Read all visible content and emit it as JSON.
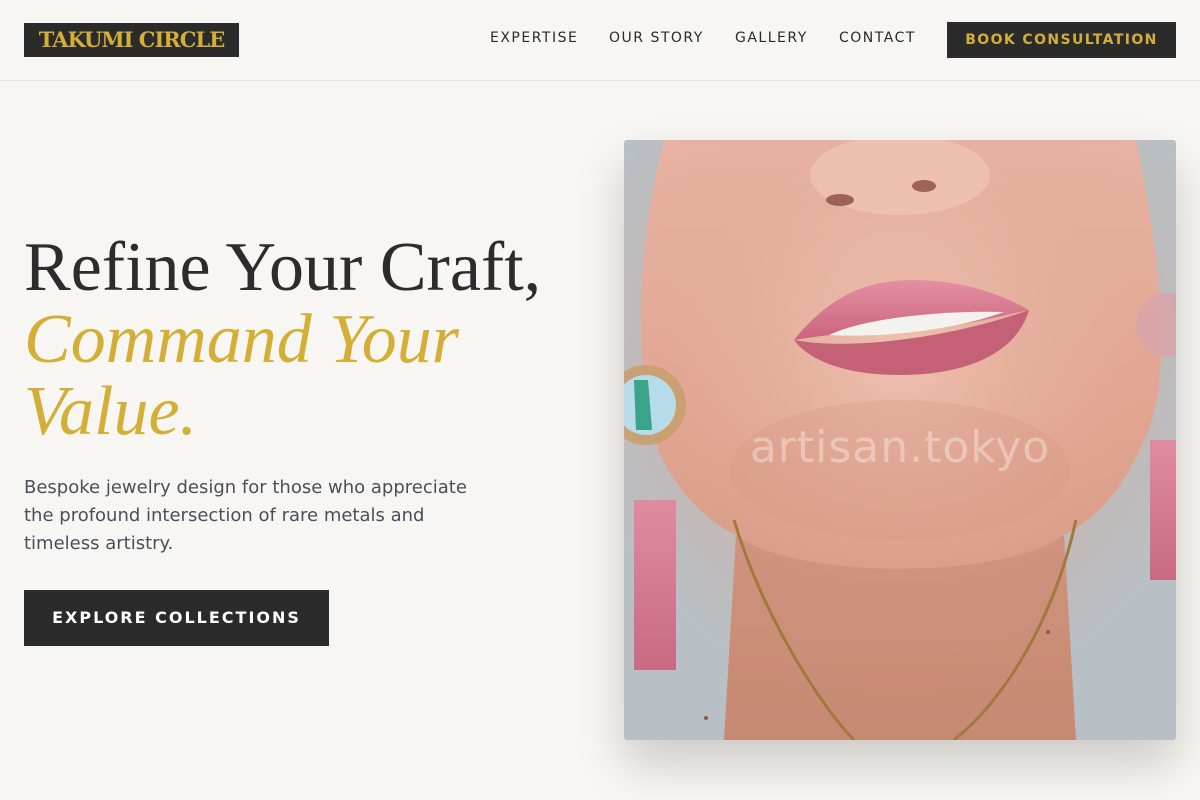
{
  "brand": {
    "name": "TAKUMI CIRCLE",
    "text_color": "#d4af37",
    "bg_color": "#2b2b2b"
  },
  "nav": {
    "items": [
      {
        "label": "EXPERTISE"
      },
      {
        "label": "OUR STORY"
      },
      {
        "label": "GALLERY"
      },
      {
        "label": "CONTACT"
      }
    ],
    "cta_label": "BOOK CONSULTATION"
  },
  "hero": {
    "title_line1": "Refine Your Craft,",
    "title_accent_line1": "Command Your",
    "title_accent_line2": "Value.",
    "subtitle": "Bespoke jewelry design for those who appreciate the profound intersection of rare metals and timeless artistry.",
    "cta_label": "EXPLORE COLLECTIONS",
    "image_watermark": "artisan.tokyo"
  },
  "colors": {
    "accent": "#d4af37",
    "dark": "#2b2b2b",
    "background": "#f7f6f2"
  }
}
